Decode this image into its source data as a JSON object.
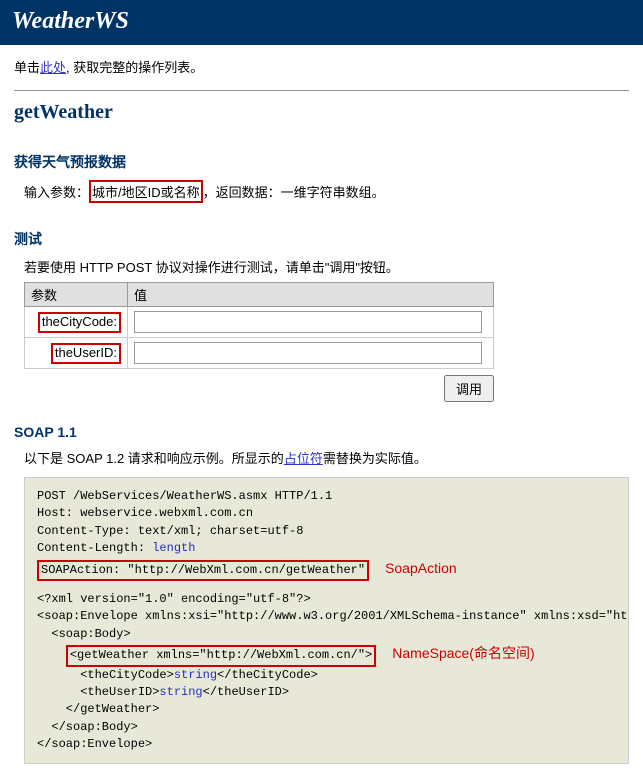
{
  "header": {
    "title": "WeatherWS"
  },
  "topline": {
    "prefix": "单击",
    "link": "此处",
    "suffix": ", 获取完整的操作列表。"
  },
  "operation": {
    "name": "getWeather"
  },
  "desc": {
    "title": "获得天气预报数据",
    "params_prefix": "输入参数：",
    "params_highlight": "城市/地区ID或名称",
    "params_suffix": "，返回数据：一维字符串数组。"
  },
  "test": {
    "title": "测试",
    "desc": "若要使用 HTTP POST 协议对操作进行测试，请单击\"调用\"按钮。",
    "col_param": "参数",
    "col_value": "值",
    "rows": [
      {
        "label": "theCityCode:"
      },
      {
        "label": "theUserID:"
      }
    ],
    "invoke": "调用"
  },
  "soap": {
    "title": "SOAP 1.1",
    "desc_prefix": "以下是 SOAP 1.2 请求和响应示例。所显示的",
    "desc_link": "占位符",
    "desc_suffix": "需替换为实际值。",
    "annot_soapaction": "SoapAction",
    "annot_namespace": "NameSpace(命名空间)",
    "code": {
      "l1": "POST /WebServices/WeatherWS.asmx HTTP/1.1",
      "l2": "Host: webservice.webxml.com.cn",
      "l3": "Content-Type: text/xml; charset=utf-8",
      "l4_prefix": "Content-Length: ",
      "l4_ph": "length",
      "l5": "SOAPAction: \"http://WebXml.com.cn/getWeather\"",
      "l6": "<?xml version=\"1.0\" encoding=\"utf-8\"?>",
      "l7": "<soap:Envelope xmlns:xsi=\"http://www.w3.org/2001/XMLSchema-instance\" xmlns:xsd=\"http://",
      "l8": "  <soap:Body>",
      "l9": "    <getWeather xmlns=\"http://WebXml.com.cn/\">",
      "l10_a": "      <theCityCode>",
      "l10_ph": "string",
      "l10_b": "</theCityCode>",
      "l11_a": "      <theUserID>",
      "l11_ph": "string",
      "l11_b": "</theUserID>",
      "l12": "    </getWeather>",
      "l13": "  </soap:Body>",
      "l14": "</soap:Envelope>"
    }
  }
}
